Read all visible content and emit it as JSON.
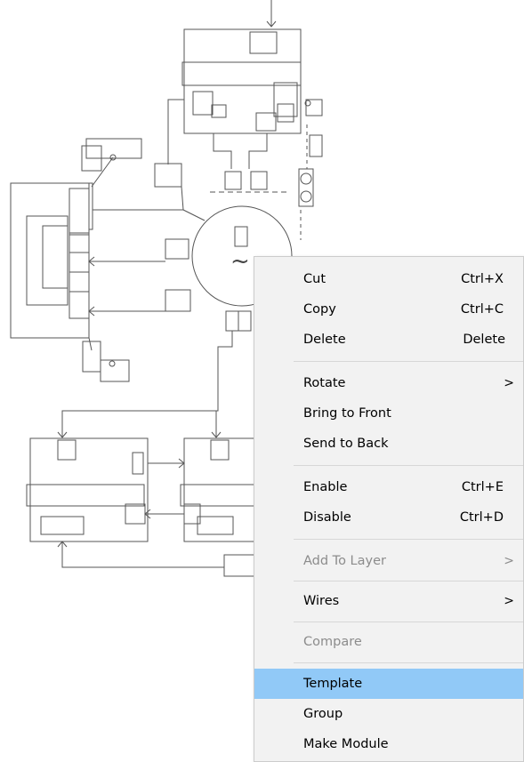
{
  "context_menu": {
    "items": [
      {
        "label": "Cut",
        "shortcut": "Ctrl+X"
      },
      {
        "label": "Copy",
        "shortcut": "Ctrl+C"
      },
      {
        "label": "Delete",
        "shortcut": "Delete"
      },
      {
        "label": "Rotate",
        "submenu": true
      },
      {
        "label": "Bring to Front"
      },
      {
        "label": "Send to Back"
      },
      {
        "label": "Enable",
        "shortcut": "Ctrl+E"
      },
      {
        "label": "Disable",
        "shortcut": "Ctrl+D"
      },
      {
        "label": "Add To Layer",
        "submenu": true,
        "disabled": true
      },
      {
        "label": "Wires",
        "submenu": true
      },
      {
        "label": "Compare",
        "disabled": true
      },
      {
        "label": "Template",
        "highlighted": true
      },
      {
        "label": "Group"
      },
      {
        "label": "Make Module"
      }
    ],
    "submenu_glyph": ">",
    "colors": {
      "background": "#f2f2f2",
      "highlight": "#91c9f7",
      "disabled_text": "#8c8c8c"
    }
  },
  "diagram": {
    "symbol": "~",
    "stroke_color": "#555555"
  }
}
